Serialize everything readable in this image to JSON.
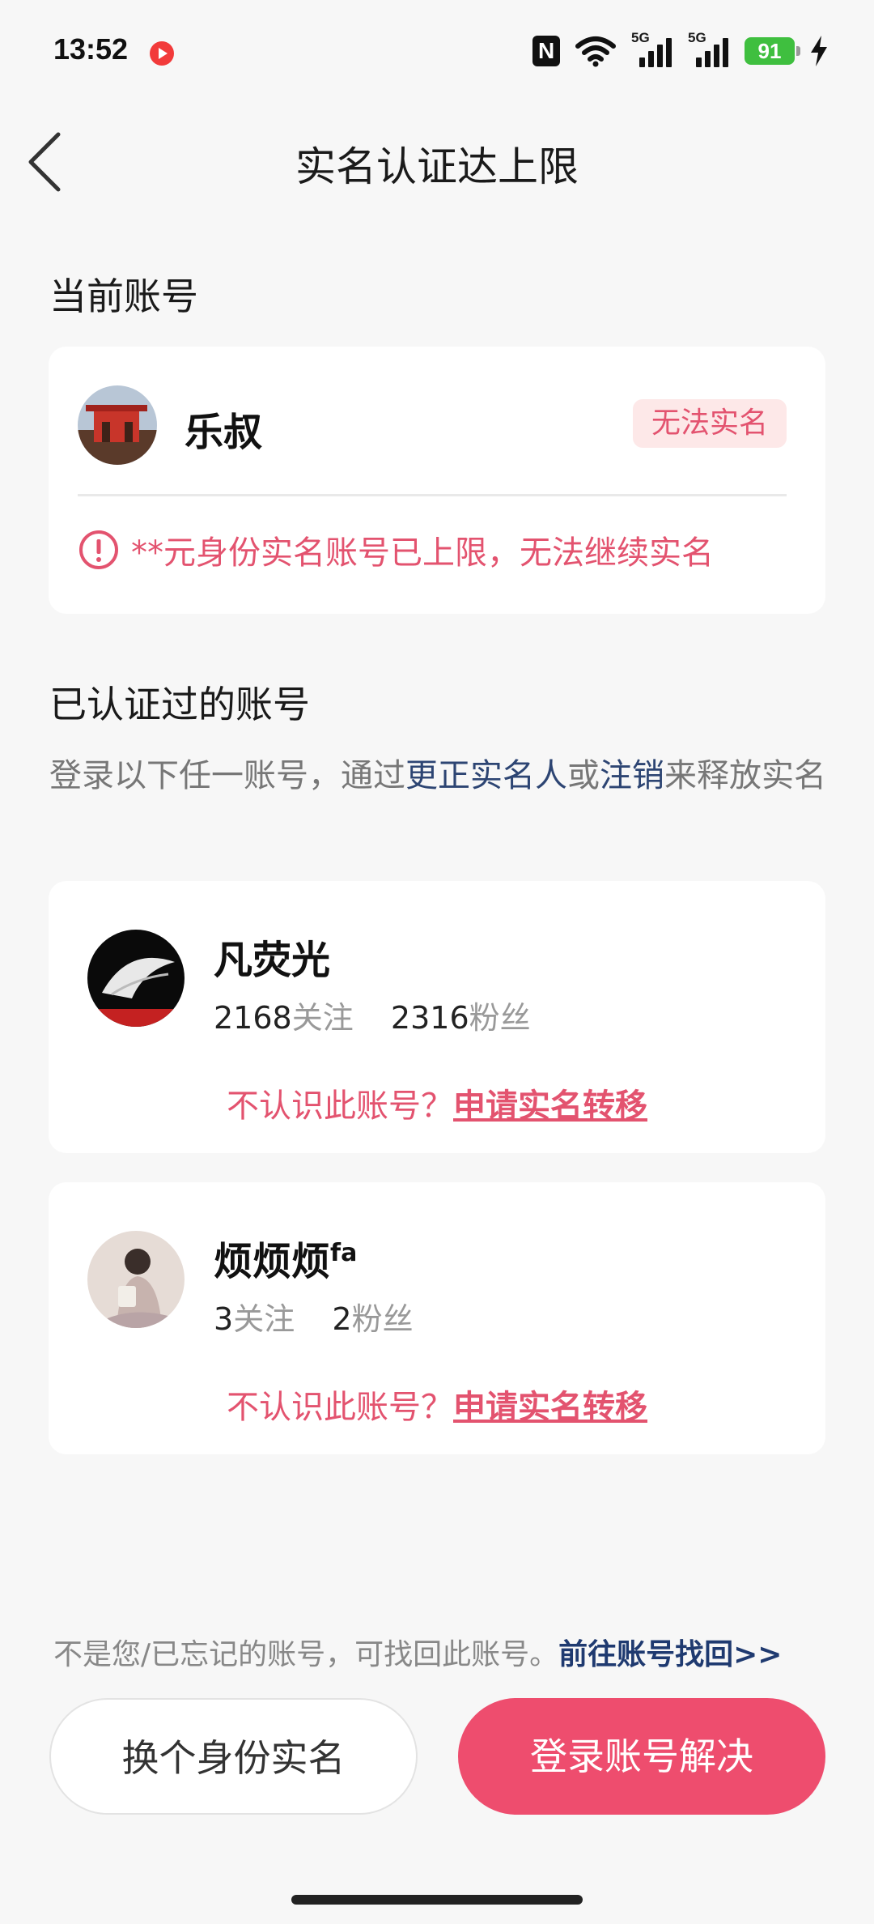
{
  "status_bar": {
    "time": "13:52",
    "network_label_1": "5G",
    "network_label_2": "5G",
    "battery": "91",
    "icons": [
      "record-icon",
      "nfc-icon",
      "wifi-icon",
      "signal-5g-icon",
      "signal-5g-icon",
      "battery-icon",
      "charging-bolt-icon"
    ]
  },
  "nav": {
    "title": "实名认证达上限",
    "back_icon": "chevron-left-icon"
  },
  "current_account": {
    "section_title": "当前账号",
    "name": "乐叔",
    "badge": "无法实名",
    "warning": "**元身份实名账号已上限，无法继续实名",
    "warning_icon": "exclamation-circle-icon"
  },
  "verified_accounts": {
    "section_title": "已认证过的账号",
    "desc_prefix": "登录以下任一账号，通过",
    "desc_link1": "更正实名人",
    "desc_mid": "或",
    "desc_link2": "注销",
    "desc_suffix": "来释放实名",
    "accounts": [
      {
        "name": "凡荧光",
        "follow_count": "2168",
        "follow_label": "关注",
        "fans_count": "2316",
        "fans_label": "粉丝",
        "transfer_prefix": "不认识此账号？",
        "transfer_link": "申请实名转移"
      },
      {
        "name": "烦烦烦",
        "name_sup": "fa",
        "follow_count": "3",
        "follow_label": "关注",
        "fans_count": "2",
        "fans_label": "粉丝",
        "transfer_prefix": "不认识此账号？",
        "transfer_link": "申请实名转移"
      }
    ]
  },
  "footer": {
    "recover_text": "不是您/已忘记的账号，可找回此账号。",
    "recover_link": "前往账号找回>>",
    "btn_change_identity": "换个身份实名",
    "btn_login_resolve": "登录账号解决"
  },
  "colors": {
    "accent": "#ee4d6e",
    "warning_text": "#e3536f",
    "link_blue": "#2d4573",
    "background": "#f7f7f7"
  }
}
